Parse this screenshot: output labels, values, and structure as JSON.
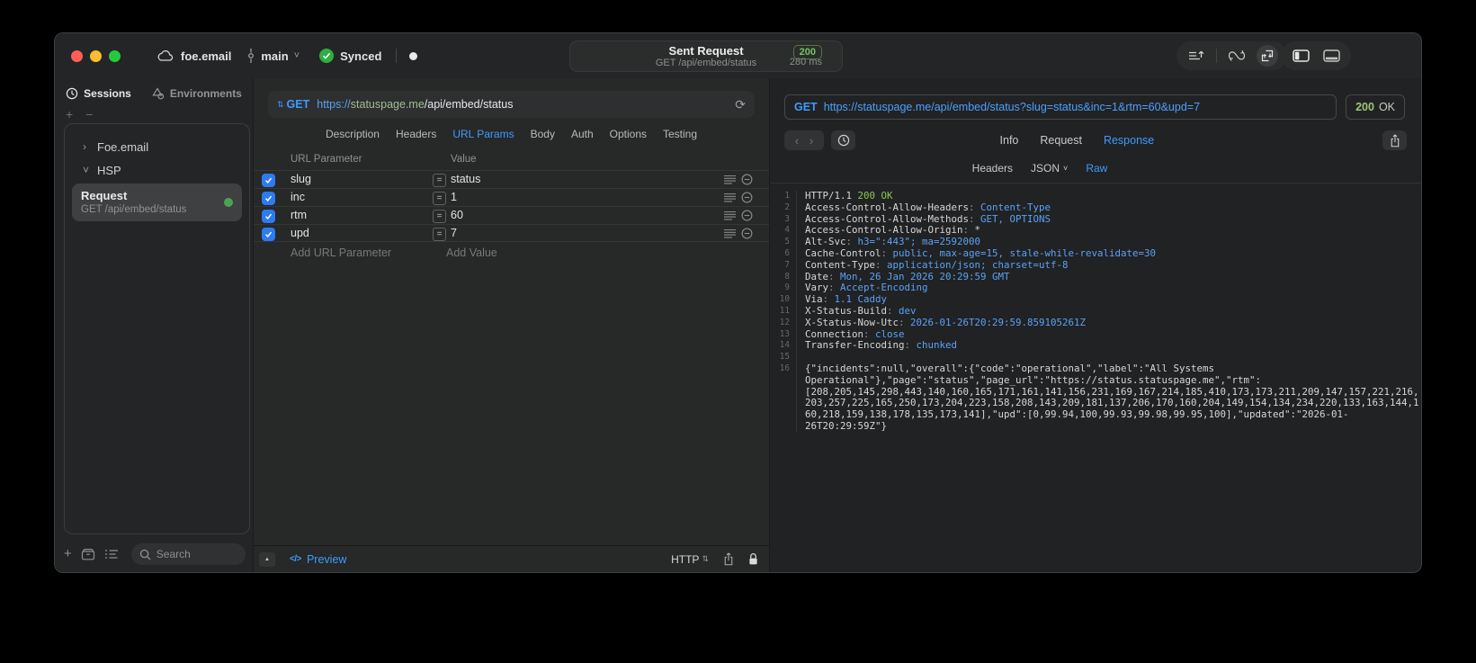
{
  "titlebar": {
    "project": "foe.email",
    "branch": "main",
    "sync_label": "Synced",
    "request_pill": {
      "title": "Sent Request",
      "subtitle": "GET /api/embed/status",
      "status_code": "200",
      "duration": "280 ms"
    }
  },
  "sidebar": {
    "tabs": {
      "sessions": "Sessions",
      "environments": "Environments"
    },
    "add_label": "+",
    "remove_label": "−",
    "tree": {
      "group1": "Foe.email",
      "group2": "HSP"
    },
    "request_item": {
      "title": "Request",
      "subtitle": "GET /api/embed/status"
    },
    "search": {
      "placeholder": "Search"
    }
  },
  "request_editor": {
    "method": "GET",
    "url": {
      "scheme": "https://",
      "host": "statuspage.me",
      "path": "/api/embed/status"
    },
    "tabs": [
      "Description",
      "Headers",
      "URL Params",
      "Body",
      "Auth",
      "Options",
      "Testing"
    ],
    "active_tab": "URL Params",
    "params_table": {
      "columns": [
        "URL Parameter",
        "Value"
      ],
      "rows": [
        {
          "enabled": true,
          "name": "slug",
          "operator": "=",
          "value": "status"
        },
        {
          "enabled": true,
          "name": "inc",
          "operator": "=",
          "value": "1"
        },
        {
          "enabled": true,
          "name": "rtm",
          "operator": "=",
          "value": "60"
        },
        {
          "enabled": true,
          "name": "upd",
          "operator": "=",
          "value": "7"
        }
      ],
      "add_row": {
        "name_placeholder": "Add URL Parameter",
        "value_placeholder": "Add Value"
      }
    },
    "footer": {
      "preview_label": "Preview",
      "code_glyph": "</>",
      "protocol_label": "HTTP"
    }
  },
  "response_viewer": {
    "method": "GET",
    "url": "https://statuspage.me/api/embed/status?slug=status&inc=1&rtm=60&upd=7",
    "status": {
      "code": "200",
      "reason": "OK"
    },
    "tabs": [
      "Info",
      "Request",
      "Response"
    ],
    "active_tab": "Response",
    "view_tabs": [
      "Headers",
      "JSON",
      "Raw"
    ],
    "active_view": "Raw",
    "status_line": {
      "protocol": "HTTP/1.1",
      "status": "200 OK"
    },
    "headers": [
      {
        "name": "Access-Control-Allow-Headers",
        "value": "Content-Type"
      },
      {
        "name": "Access-Control-Allow-Methods",
        "value": "GET, OPTIONS"
      },
      {
        "name": "Access-Control-Allow-Origin",
        "value": "*"
      },
      {
        "name": "Alt-Svc",
        "value": "h3=\":443\"; ma=2592000"
      },
      {
        "name": "Cache-Control",
        "value": "public, max-age=15, stale-while-revalidate=30"
      },
      {
        "name": "Content-Type",
        "value": "application/json; charset=utf-8"
      },
      {
        "name": "Date",
        "value": "Mon, 26 Jan 2026 20:29:59 GMT"
      },
      {
        "name": "Vary",
        "value": "Accept-Encoding"
      },
      {
        "name": "Via",
        "value": "1.1 Caddy"
      },
      {
        "name": "X-Status-Build",
        "value": "dev"
      },
      {
        "name": "X-Status-Now-Utc",
        "value": "2026-01-26T20:29:59.859105261Z"
      },
      {
        "name": "Connection",
        "value": "close"
      },
      {
        "name": "Transfer-Encoding",
        "value": "chunked"
      }
    ],
    "body": "{\"incidents\":null,\"overall\":{\"code\":\"operational\",\"label\":\"All Systems Operational\"},\"page\":\"status\",\"page_url\":\"https://status.statuspage.me\",\"rtm\":[208,205,145,298,443,140,160,165,171,161,141,156,231,169,167,214,185,410,173,173,211,209,147,157,221,216,203,257,225,165,250,173,204,223,158,208,143,209,181,137,206,170,160,204,149,154,134,234,220,133,163,144,160,218,159,138,178,135,173,141],\"upd\":[0,99.94,100,99.93,99.98,99.95,100],\"updated\":\"2026-01-26T20:29:59Z\"}"
  },
  "colors": {
    "accent_blue": "#3e9bff",
    "value_blue": "#5aa2f7",
    "status_green": "#8fc54d",
    "badge_green": "#74c365",
    "checkbox_blue": "#2d7bf0"
  }
}
